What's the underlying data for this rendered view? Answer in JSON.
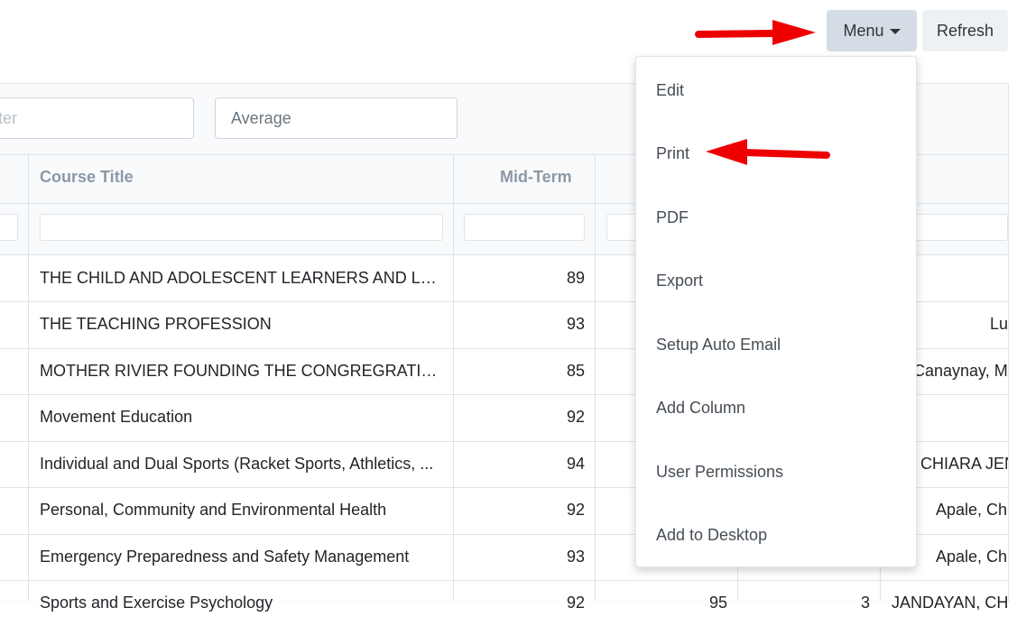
{
  "toolbar": {
    "menu_label": "Menu",
    "refresh_label": "Refresh"
  },
  "filters": {
    "semester_placeholder": "ester",
    "average_placeholder": "Average"
  },
  "table": {
    "headers": {
      "course_title": "Course Title",
      "mid_term": "Mid-Term"
    },
    "rows": [
      {
        "title": "THE CHILD AND ADOLESCENT LEARNERS AND LEA...",
        "mid": "89",
        "final": "",
        "units": "",
        "instructor": ""
      },
      {
        "title": "THE TEACHING PROFESSION",
        "mid": "93",
        "final": "",
        "units": "",
        "instructor": "Lu"
      },
      {
        "title": "MOTHER RIVIER FOUNDING THE CONGREGRATION",
        "mid": "85",
        "final": "",
        "units": "",
        "instructor": "Canaynay, M"
      },
      {
        "title": "Movement Education",
        "mid": "92",
        "final": "",
        "units": "",
        "instructor": ""
      },
      {
        "title": "Individual and Dual Sports (Racket Sports, Athletics, ...",
        "mid": "94",
        "final": "",
        "units": "",
        "instructor": "CHIARA JEN"
      },
      {
        "title": "Personal, Community and Environmental Health",
        "mid": "92",
        "final": "",
        "units": "",
        "instructor": "Apale, Ch"
      },
      {
        "title": "Emergency Preparedness and Safety Management",
        "mid": "93",
        "final": "",
        "units": "",
        "instructor": "Apale, Ch"
      },
      {
        "title": "Sports and Exercise Psychology",
        "mid": "92",
        "final": "95",
        "units": "3",
        "instructor": "JANDAYAN, CHI"
      }
    ]
  },
  "menu": {
    "items": [
      "Edit",
      "Print",
      "PDF",
      "Export",
      "Setup Auto Email",
      "Add Column",
      "User Permissions",
      "Add to Desktop"
    ]
  },
  "colors": {
    "arrow": "#ee0000",
    "menu_button": "#d4dde5",
    "header_text": "#8c99a6"
  }
}
